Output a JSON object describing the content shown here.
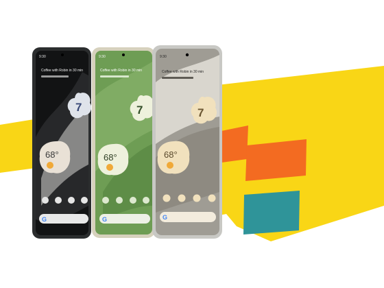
{
  "palette": {
    "yellow": "#f9d616",
    "orange": "#f36b21",
    "teal": "#2f9499"
  },
  "phones": [
    {
      "id": "obsidian",
      "frame": "#2b2d2e",
      "screen_bg": "#121314",
      "status_time": "9:30",
      "event": "Coffee with Robin in 30 min",
      "date": "Tue 5 ·",
      "clock_hour": "7",
      "temperature": "68°"
    },
    {
      "id": "lemongrass",
      "frame": "#d6d1bd",
      "screen_bg": "#6e9d54",
      "status_time": "9:30",
      "event": "Coffee with Robin in 30 min",
      "date": "Tue 5 ·",
      "clock_hour": "7",
      "temperature": "68°"
    },
    {
      "id": "snow",
      "frame": "#c8c8c4",
      "screen_bg": "#9f9c94",
      "status_time": "9:30",
      "event": "Coffee with Robin in 30 min",
      "date": "Tue 5 ·",
      "clock_hour": "7",
      "temperature": "68°"
    }
  ]
}
